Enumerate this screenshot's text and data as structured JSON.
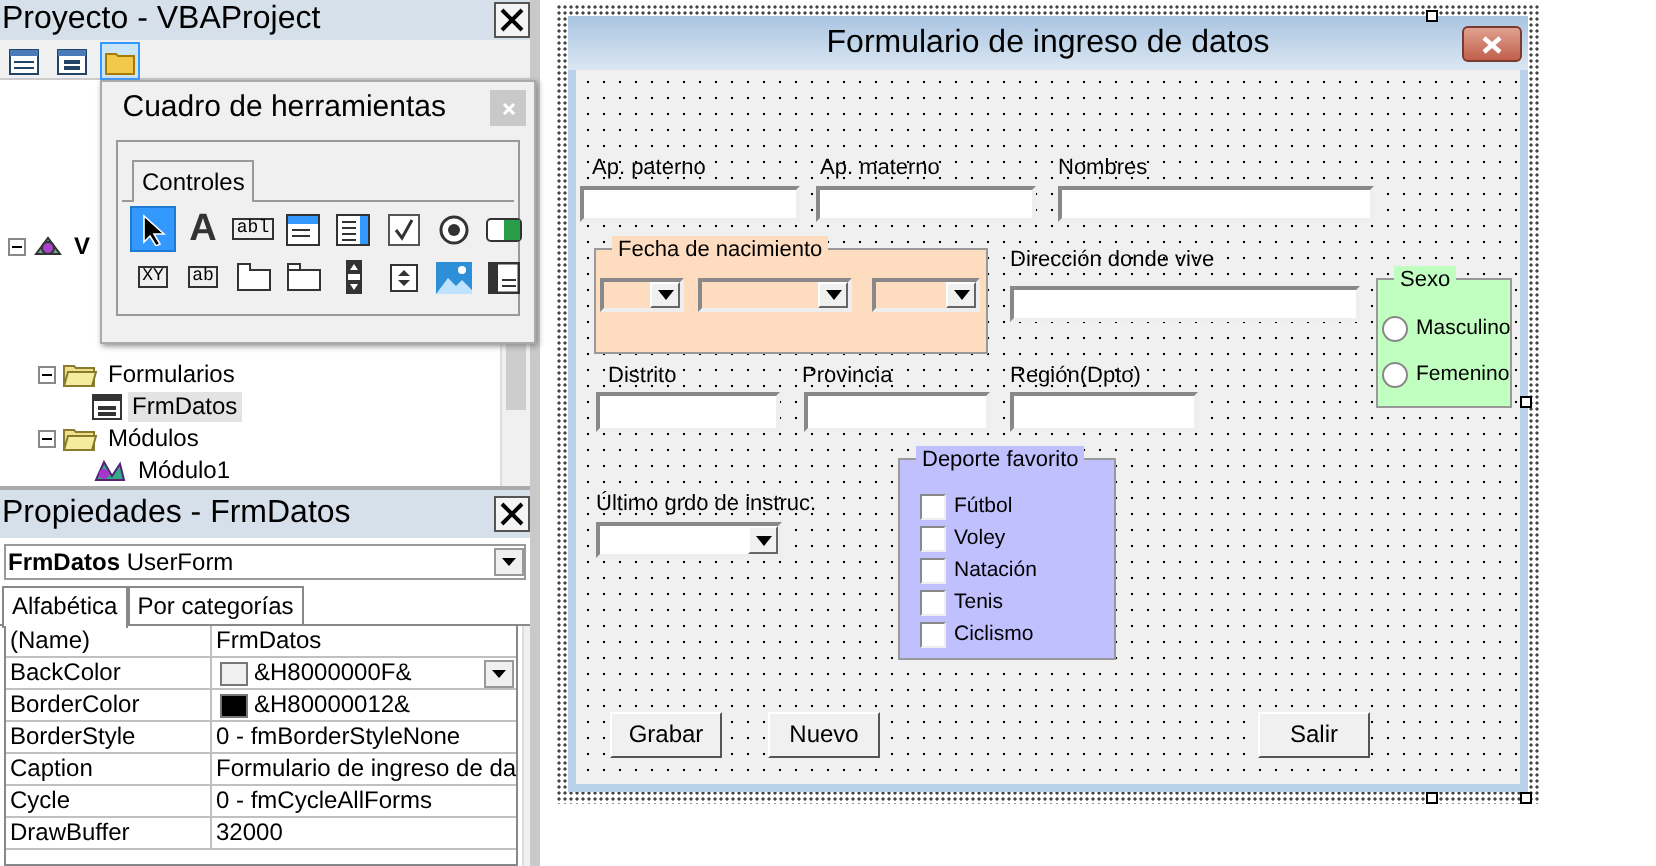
{
  "project_panel": {
    "title": "Proyecto - VBAProject",
    "toolbar": [
      {
        "kind": "code",
        "selected": false
      },
      {
        "kind": "object",
        "selected": false
      },
      {
        "kind": "folders",
        "selected": true
      }
    ],
    "tree": [
      {
        "label": "V",
        "kind": "project",
        "expanded": true,
        "selected": false,
        "children": [
          {
            "label": "Formularios",
            "kind": "folder",
            "expanded": true,
            "selected": false,
            "children": [
              {
                "label": "FrmDatos",
                "kind": "form",
                "selected": true
              }
            ]
          },
          {
            "label": "Módulos",
            "kind": "folder",
            "expanded": true,
            "selected": false,
            "children": [
              {
                "label": "Módulo1",
                "kind": "module",
                "selected": false
              }
            ]
          }
        ]
      }
    ]
  },
  "properties_panel": {
    "title": "Propiedades - FrmDatos",
    "object_selector": "**FrmDatos** UserForm",
    "tabs": [
      {
        "label": "Alfabética",
        "selected": true
      },
      {
        "label": "Por categorías",
        "selected": false
      }
    ],
    "rows": [
      {
        "name": "(Name)",
        "value": "FrmDatos",
        "selected": false
      },
      {
        "name": "BackColor",
        "value": "&H8000000F&",
        "color": "#f0f0f0",
        "selected": true
      },
      {
        "name": "BorderColor",
        "value": "&H80000012&",
        "color": "#000000",
        "selected": false
      },
      {
        "name": "BorderStyle",
        "value": "0 - fmBorderStyleNone",
        "selected": false
      },
      {
        "name": "Caption",
        "value": "Formulario de ingreso de da",
        "selected": false
      },
      {
        "name": "Cycle",
        "value": "0 - fmCycleAllForms",
        "selected": false
      },
      {
        "name": "DrawBuffer",
        "value": "32000",
        "selected": false
      }
    ]
  },
  "toolbox": {
    "title": "Cuadro de herramientas",
    "tabs": [
      {
        "label": "Controles",
        "selected": true
      }
    ],
    "tools": [
      {
        "kind": "pointer",
        "selected": true
      },
      {
        "kind": "label",
        "glyph": "A",
        "selected": false
      },
      {
        "kind": "textbox",
        "glyph": "abl",
        "selected": false
      },
      {
        "kind": "combobox",
        "selected": false
      },
      {
        "kind": "listbox",
        "selected": false
      },
      {
        "kind": "checkbox",
        "selected": false
      },
      {
        "kind": "option",
        "selected": false
      },
      {
        "kind": "toggle",
        "selected": false
      },
      {
        "kind": "frame",
        "glyph": "XY",
        "selected": false
      },
      {
        "kind": "command",
        "glyph": "ab",
        "selected": false
      },
      {
        "kind": "tabstrip",
        "selected": false
      },
      {
        "kind": "multipage",
        "selected": false
      },
      {
        "kind": "scrollbar",
        "selected": false
      },
      {
        "kind": "spin",
        "selected": false
      },
      {
        "kind": "image",
        "selected": false
      },
      {
        "kind": "refedit",
        "selected": false
      }
    ]
  },
  "form": {
    "title": "Formulario de ingreso de datos",
    "controls": [
      {
        "kind": "label",
        "text": "Ap. paterno"
      },
      {
        "kind": "textbox"
      },
      {
        "kind": "label",
        "text": "Ap. materno"
      },
      {
        "kind": "textbox"
      },
      {
        "kind": "label",
        "text": "Nombres"
      },
      {
        "kind": "textbox"
      },
      {
        "kind": "frame",
        "text": "Fecha de nacimiento",
        "color": "#fddcbf",
        "children": [
          {
            "kind": "combobox"
          },
          {
            "kind": "combobox"
          },
          {
            "kind": "combobox"
          }
        ]
      },
      {
        "kind": "label",
        "text": "Dirección donde vive"
      },
      {
        "kind": "textbox"
      },
      {
        "kind": "label",
        "text": "Distrito"
      },
      {
        "kind": "textbox"
      },
      {
        "kind": "label",
        "text": "Provincia"
      },
      {
        "kind": "textbox"
      },
      {
        "kind": "label",
        "text": "Región(Dpto)"
      },
      {
        "kind": "textbox"
      },
      {
        "kind": "frame",
        "text": "Sexo",
        "color": "#c0ffc0",
        "children": [
          {
            "kind": "radio",
            "text": "Masculino",
            "checked": false
          },
          {
            "kind": "radio",
            "text": "Femenino",
            "checked": false
          }
        ]
      },
      {
        "kind": "label",
        "text": "Último grdo de instruc."
      },
      {
        "kind": "combobox"
      },
      {
        "kind": "frame",
        "text": "Deporte favorito",
        "color": "#c0c0ff",
        "children": [
          {
            "kind": "checkbox",
            "text": "Fútbol",
            "checked": false
          },
          {
            "kind": "checkbox",
            "text": "Voley",
            "checked": false
          },
          {
            "kind": "checkbox",
            "text": "Natación",
            "checked": false
          },
          {
            "kind": "checkbox",
            "text": "Tenis",
            "checked": false
          },
          {
            "kind": "checkbox",
            "text": "Ciclismo",
            "checked": false
          }
        ]
      },
      {
        "kind": "button",
        "text": "Grabar"
      },
      {
        "kind": "button",
        "text": "Nuevo"
      },
      {
        "kind": "button",
        "text": "Salir"
      }
    ]
  }
}
